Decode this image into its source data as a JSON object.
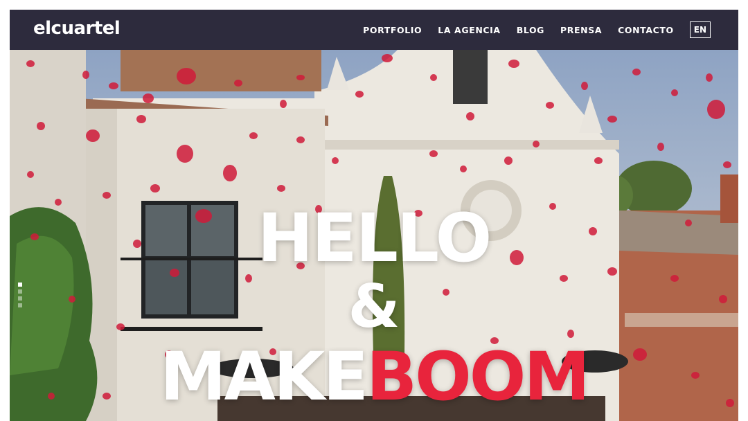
{
  "brand": {
    "logo": "elcuartel"
  },
  "nav": {
    "items": [
      {
        "label": "PORTFOLIO"
      },
      {
        "label": "LA AGENCIA"
      },
      {
        "label": "BLOG"
      },
      {
        "label": "PRENSA"
      },
      {
        "label": "CONTACTO"
      }
    ],
    "language": "EN"
  },
  "hero": {
    "line1": "HELLO",
    "line2": "&",
    "line3_white": "MAKE",
    "line3_accent": "BOOM",
    "accent_color": "#e8243c",
    "slides": {
      "count": 4,
      "active": 1
    }
  },
  "colors": {
    "navbar": "#2d2b3d",
    "text": "#ffffff"
  }
}
